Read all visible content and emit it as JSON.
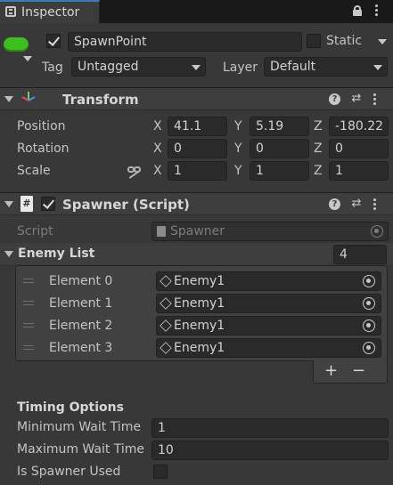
{
  "window": {
    "tab_label": "Inspector"
  },
  "header": {
    "object_name": "SpawnPoint",
    "static_label": "Static",
    "tag_label": "Tag",
    "tag_value": "Untagged",
    "layer_label": "Layer",
    "layer_value": "Default",
    "active": true
  },
  "transform": {
    "title": "Transform",
    "position_label": "Position",
    "rotation_label": "Rotation",
    "scale_label": "Scale",
    "axis_x": "X",
    "axis_y": "Y",
    "axis_z": "Z",
    "position": {
      "x": "41.1",
      "y": "5.19",
      "z": "-180.22"
    },
    "rotation": {
      "x": "0",
      "y": "0",
      "z": "0"
    },
    "scale": {
      "x": "1",
      "y": "1",
      "z": "1"
    }
  },
  "spawner": {
    "title": "Spawner (Script)",
    "enabled": true,
    "script_label": "Script",
    "script_value": "Spawner",
    "enemy_list_label": "Enemy List",
    "enemy_list_size": "4",
    "elements": [
      {
        "label": "Element 0",
        "value": "Enemy1"
      },
      {
        "label": "Element 1",
        "value": "Enemy1"
      },
      {
        "label": "Element 2",
        "value": "Enemy1"
      },
      {
        "label": "Element 3",
        "value": "Enemy1"
      }
    ],
    "add_label": "+",
    "remove_label": "−",
    "timing_header": "Timing Options",
    "min_wait_label": "Minimum Wait Time",
    "min_wait_value": "1",
    "max_wait_label": "Maximum Wait Time",
    "max_wait_value": "10",
    "is_used_label": "Is Spawner Used",
    "is_used": false
  },
  "colors": {
    "background": "#383838",
    "field": "#2a2a2a",
    "active_pill": "#3fbf1f",
    "tab_bg": "#3c3c3c"
  }
}
